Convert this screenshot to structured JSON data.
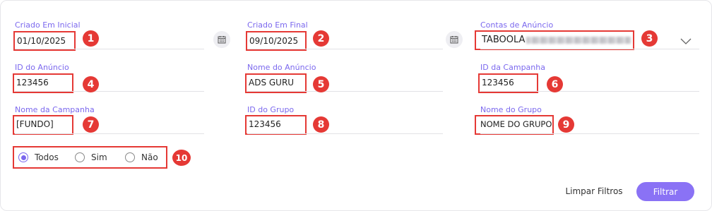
{
  "filters": {
    "created_start": {
      "label": "Criado Em Inicial",
      "value": "01/10/2025",
      "badge": "1"
    },
    "created_end": {
      "label": "Criado Em Final",
      "value": "09/10/2025",
      "badge": "2"
    },
    "ad_accounts": {
      "label": "Contas de Anúncio",
      "value": "TABOOLA",
      "badge": "3"
    },
    "ad_id": {
      "label": "ID do Anúncio",
      "value": "123456",
      "badge": "4"
    },
    "ad_name": {
      "label": "Nome do Anúncio",
      "value": "ADS GURU",
      "badge": "5"
    },
    "campaign_id": {
      "label": "ID da Campanha",
      "value": "123456",
      "badge": "6"
    },
    "campaign_name": {
      "label": "Nome da Campanha",
      "value": "[FUNDO]",
      "badge": "7"
    },
    "group_id": {
      "label": "ID do Grupo",
      "value": "123456",
      "badge": "8"
    },
    "group_name": {
      "label": "Nome do Grupo",
      "value": "NOME DO GRUPO",
      "badge": "9"
    }
  },
  "radio": {
    "badge": "10",
    "options": [
      {
        "label": "Todos",
        "selected": true
      },
      {
        "label": "Sim",
        "selected": false
      },
      {
        "label": "Não",
        "selected": false
      }
    ]
  },
  "actions": {
    "clear_label": "Limpar Filtros",
    "filter_label": "Filtrar"
  },
  "colors": {
    "accent": "#7b68ee",
    "annotation": "#e53935",
    "button": "#8a72f5"
  }
}
